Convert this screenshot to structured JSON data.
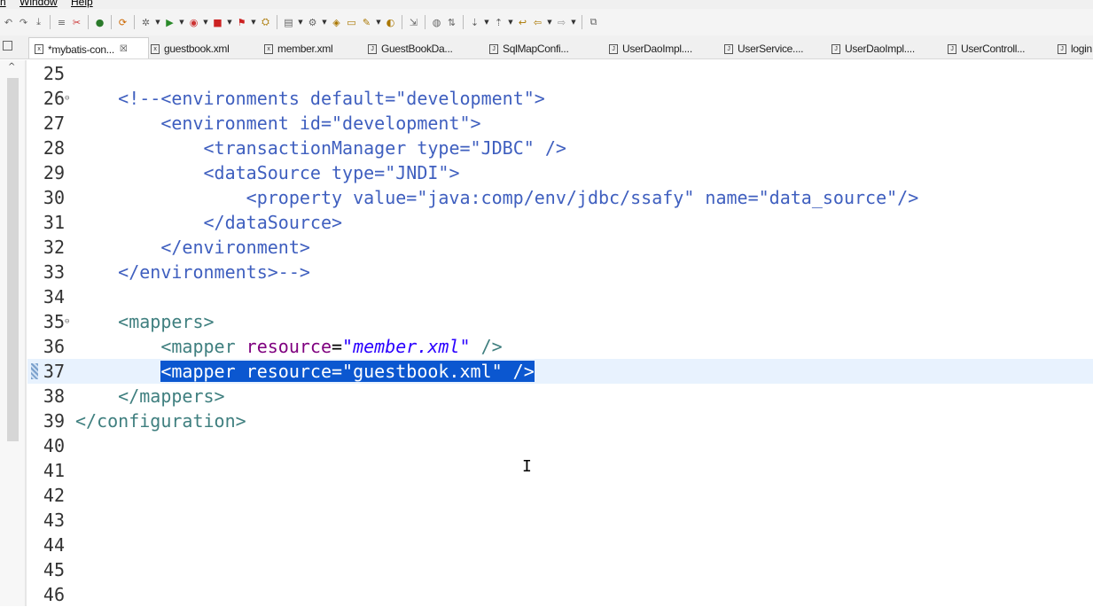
{
  "menu": [
    "Window",
    "Help"
  ],
  "tabs": [
    {
      "label": "*mybatis-con...",
      "icon": "x",
      "active": true,
      "close": "☒"
    },
    {
      "label": "guestbook.xml",
      "icon": "x"
    },
    {
      "label": "member.xml",
      "icon": "x"
    },
    {
      "label": "GuestBookDa...",
      "icon": "J"
    },
    {
      "label": "SqlMapConfi...",
      "icon": "J"
    },
    {
      "label": "UserDaoImpl....",
      "icon": "J"
    },
    {
      "label": "UserService....",
      "icon": "J"
    },
    {
      "label": "UserDaoImpl....",
      "icon": "J"
    },
    {
      "label": "UserControll...",
      "icon": "J"
    },
    {
      "label": "login",
      "icon": "J"
    }
  ],
  "editor": {
    "selected_line": 37,
    "lines": [
      {
        "num": "25",
        "code": ""
      },
      {
        "num": "26",
        "code": "    <!--<environments default=\"development\">",
        "fold": true
      },
      {
        "num": "27",
        "code": "        <environment id=\"development\">"
      },
      {
        "num": "28",
        "code": "            <transactionManager type=\"JDBC\" />"
      },
      {
        "num": "29",
        "code": "            <dataSource type=\"JNDI\">"
      },
      {
        "num": "30",
        "code": "                <property value=\"java:comp/env/jdbc/ssafy\" name=\"data_source\"/>"
      },
      {
        "num": "31",
        "code": "            </dataSource>"
      },
      {
        "num": "32",
        "code": "        </environment>"
      },
      {
        "num": "33",
        "code": "    </environments>-->"
      },
      {
        "num": "34",
        "code": ""
      },
      {
        "num": "35",
        "code": "    <mappers>",
        "fold": true
      },
      {
        "num": "36",
        "code": "        <mapper resource=\"member.xml\" />"
      },
      {
        "num": "37",
        "code": "        <mapper resource=\"guestbook.xml\" />"
      },
      {
        "num": "38",
        "code": "    </mappers>"
      },
      {
        "num": "39",
        "code": "</configuration>"
      },
      {
        "num": "40",
        "code": ""
      },
      {
        "num": "41",
        "code": ""
      },
      {
        "num": "42",
        "code": ""
      },
      {
        "num": "43",
        "code": ""
      },
      {
        "num": "44",
        "code": ""
      },
      {
        "num": "45",
        "code": ""
      },
      {
        "num": "46",
        "code": ""
      }
    ]
  },
  "icons": {
    "text_cursor": "I",
    "fold_marker": "⊖",
    "scroll_up": "^"
  }
}
